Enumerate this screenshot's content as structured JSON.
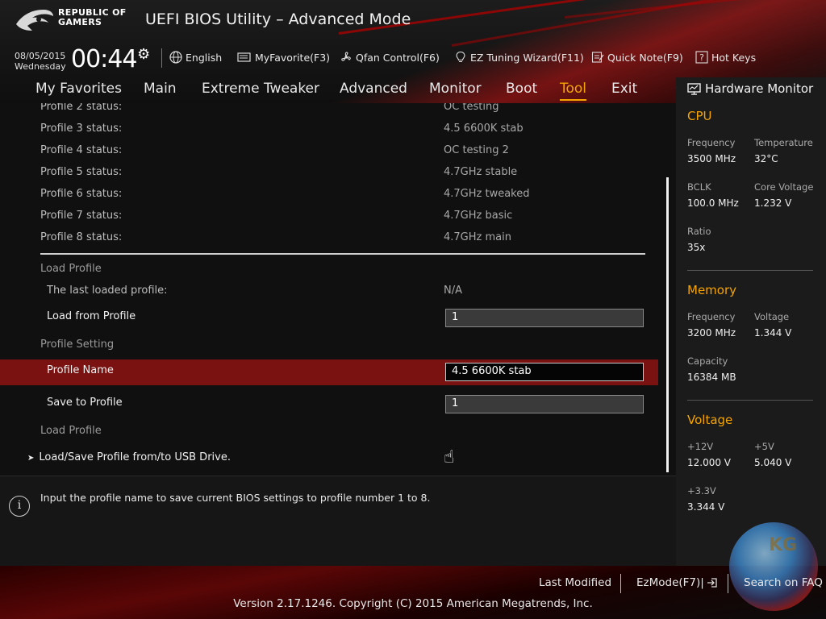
{
  "header": {
    "brand_line1": "REPUBLIC OF",
    "brand_line2": "GAMERS",
    "title": "UEFI BIOS Utility – Advanced Mode",
    "date": "08/05/2015",
    "weekday": "Wednesday",
    "time": "00:44",
    "toolbar": [
      {
        "label": "English",
        "icon": "globe-icon"
      },
      {
        "label": "MyFavorite(F3)",
        "icon": "favorite-icon"
      },
      {
        "label": "Qfan Control(F6)",
        "icon": "fan-icon"
      },
      {
        "label": "EZ Tuning Wizard(F11)",
        "icon": "lightbulb-icon"
      },
      {
        "label": "Quick Note(F9)",
        "icon": "note-icon"
      },
      {
        "label": "Hot Keys",
        "icon": "question-icon"
      }
    ]
  },
  "nav": {
    "tabs": [
      {
        "label": "My Favorites"
      },
      {
        "label": "Main"
      },
      {
        "label": "Extreme Tweaker"
      },
      {
        "label": "Advanced"
      },
      {
        "label": "Monitor"
      },
      {
        "label": "Boot"
      },
      {
        "label": "Tool"
      },
      {
        "label": "Exit"
      }
    ],
    "active": "Tool"
  },
  "main": {
    "profiles": [
      {
        "label": "Profile 2 status:",
        "value": "OC testing"
      },
      {
        "label": "Profile 3 status:",
        "value": "4.5 6600K stab"
      },
      {
        "label": "Profile 4 status:",
        "value": "OC testing 2"
      },
      {
        "label": "Profile 5 status:",
        "value": "4.7GHz stable"
      },
      {
        "label": "Profile 6 status:",
        "value": "4.7GHz tweaked"
      },
      {
        "label": "Profile 7 status:",
        "value": "4.7GHz basic"
      },
      {
        "label": "Profile 8 status:",
        "value": "4.7GHz main"
      }
    ],
    "load_profile_group": "Load Profile",
    "last_loaded_label": "The last loaded profile:",
    "last_loaded_value": "N/A",
    "load_from_label": "Load from Profile",
    "load_from_value": "1",
    "profile_setting_group": "Profile Setting",
    "profile_name_label": "Profile Name",
    "profile_name_value": "4.5 6600K stab",
    "save_to_label": "Save to Profile",
    "save_to_value": "1",
    "load_profile_group2": "Load Profile",
    "usb_item": "Load/Save Profile from/to USB Drive.",
    "usb_arrow": "➤"
  },
  "help": {
    "icon": "i",
    "text": "Input the profile name to save current BIOS settings to profile number 1 to 8."
  },
  "hardware_monitor": {
    "title": "Hardware Monitor",
    "cpu": {
      "title": "CPU",
      "frequency_label": "Frequency",
      "frequency": "3500 MHz",
      "temperature_label": "Temperature",
      "temperature": "32°C",
      "bclk_label": "BCLK",
      "bclk": "100.0 MHz",
      "core_voltage_label": "Core Voltage",
      "core_voltage": "1.232 V",
      "ratio_label": "Ratio",
      "ratio": "35x"
    },
    "memory": {
      "title": "Memory",
      "frequency_label": "Frequency",
      "frequency": "3200 MHz",
      "voltage_label": "Voltage",
      "voltage": "1.344 V",
      "capacity_label": "Capacity",
      "capacity": "16384 MB"
    },
    "voltage": {
      "title": "Voltage",
      "v12_label": "+12V",
      "v12": "12.000 V",
      "v5_label": "+5V",
      "v5": "5.040 V",
      "v33_label": "+3.3V",
      "v33": "3.344 V"
    }
  },
  "footer": {
    "last_modified": "Last Modified",
    "ezmode": "EzMode(F7)|",
    "search": "Search on FAQ",
    "copyright": "Version 2.17.1246. Copyright (C) 2015 American Megatrends, Inc.",
    "watermark": "KG"
  }
}
